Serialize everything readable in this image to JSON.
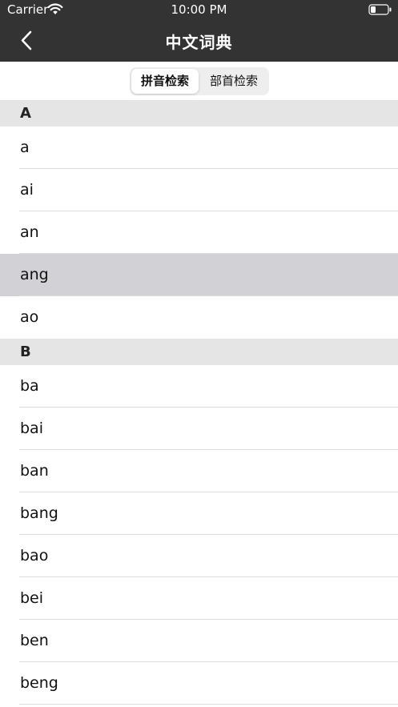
{
  "status_bar": {
    "carrier": "Carrier",
    "time": "10:00 PM",
    "icons": [
      "wifi-icon",
      "battery-icon"
    ]
  },
  "nav": {
    "title": "中文词典",
    "back_icon": "chevron-left-icon"
  },
  "segments": {
    "selected": "拼音检索",
    "other": "部首检索"
  },
  "sections": [
    {
      "header": "A",
      "items": [
        "a",
        "ai",
        "an",
        "ang",
        "ao"
      ]
    },
    {
      "header": "B",
      "items": [
        "ba",
        "bai",
        "ban",
        "bang",
        "bao",
        "bei",
        "ben",
        "beng"
      ]
    }
  ],
  "highlighted_item": "ang",
  "colors": {
    "bar": "#333333",
    "section_header_bg": "#e5e5e5",
    "highlight_bg": "#d1d1d6"
  }
}
